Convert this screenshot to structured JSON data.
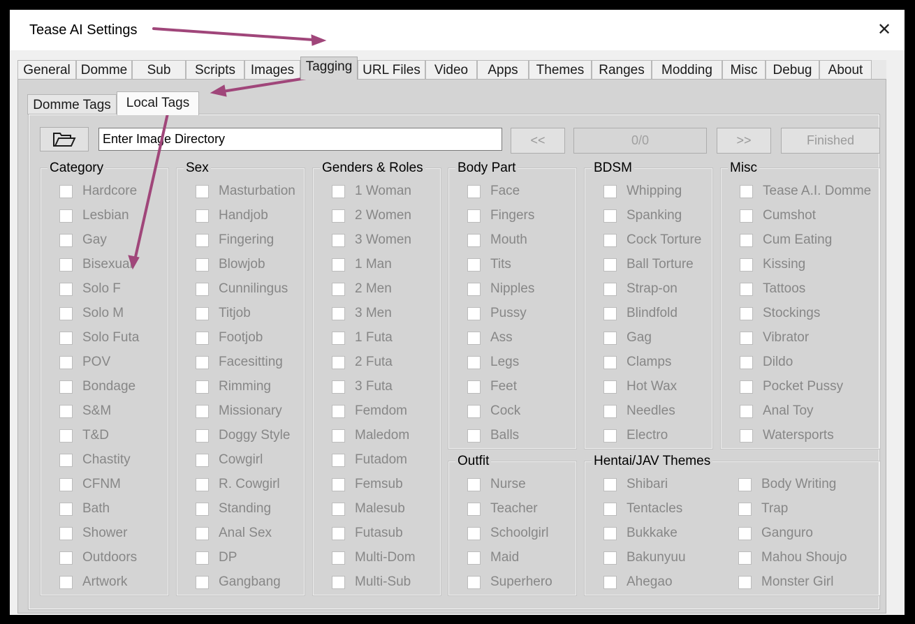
{
  "window": {
    "title": "Tease AI Settings",
    "close_glyph": "✕"
  },
  "main_tabs": [
    "General",
    "Domme",
    "Sub",
    "Scripts",
    "Images",
    "Tagging",
    "URL Files",
    "Video",
    "Apps",
    "Themes",
    "Ranges",
    "Modding",
    "Misc",
    "Debug",
    "About"
  ],
  "active_main_tab": "Tagging",
  "sub_tabs": [
    "Domme Tags",
    "Local Tags"
  ],
  "active_sub_tab": "Local Tags",
  "toolbar": {
    "folder_icon": "folder-open-icon",
    "directory_value": "Enter Image Directory",
    "prev_label": "<<",
    "progress_label": "0/0",
    "next_label": ">>",
    "finished_label": "Finished"
  },
  "groups": [
    {
      "label": "Category",
      "items": [
        "Hardcore",
        "Lesbian",
        "Gay",
        "Bisexual",
        "Solo F",
        "Solo M",
        "Solo Futa",
        "POV",
        "Bondage",
        "S&M",
        "T&D",
        "Chastity",
        "CFNM",
        "Bath",
        "Shower",
        "Outdoors",
        "Artwork"
      ]
    },
    {
      "label": "Sex",
      "items": [
        "Masturbation",
        "Handjob",
        "Fingering",
        "Blowjob",
        "Cunnilingus",
        "Titjob",
        "Footjob",
        "Facesitting",
        "Rimming",
        "Missionary",
        "Doggy Style",
        "Cowgirl",
        "R. Cowgirl",
        "Standing",
        "Anal Sex",
        "DP",
        "Gangbang"
      ]
    },
    {
      "label": "Genders & Roles",
      "items": [
        "1 Woman",
        "2 Women",
        "3 Women",
        "1 Man",
        "2 Men",
        "3 Men",
        "1 Futa",
        "2 Futa",
        "3 Futa",
        "Femdom",
        "Maledom",
        "Futadom",
        "Femsub",
        "Malesub",
        "Futasub",
        "Multi-Dom",
        "Multi-Sub"
      ]
    },
    {
      "label": "Body Part",
      "items": [
        "Face",
        "Fingers",
        "Mouth",
        "Tits",
        "Nipples",
        "Pussy",
        "Ass",
        "Legs",
        "Feet",
        "Cock",
        "Balls"
      ]
    },
    {
      "label": "BDSM",
      "items": [
        "Whipping",
        "Spanking",
        "Cock Torture",
        "Ball Torture",
        "Strap-on",
        "Blindfold",
        "Gag",
        "Clamps",
        "Hot Wax",
        "Needles",
        "Electro"
      ]
    },
    {
      "label": "Misc",
      "items": [
        "Tease A.I. Domme",
        "Cumshot",
        "Cum Eating",
        "Kissing",
        "Tattoos",
        "Stockings",
        "Vibrator",
        "Dildo",
        "Pocket Pussy",
        "Anal Toy",
        "Watersports"
      ]
    },
    {
      "label": "Outfit",
      "items": [
        "Nurse",
        "Teacher",
        "Schoolgirl",
        "Maid",
        "Superhero"
      ]
    },
    {
      "label": "Hentai/JAV Themes",
      "columns": [
        [
          "Shibari",
          "Tentacles",
          "Bukkake",
          "Bakunyuu",
          "Ahegao"
        ],
        [
          "Body Writing",
          "Trap",
          "Ganguro",
          "Mahou Shoujo",
          "Monster Girl"
        ]
      ]
    }
  ],
  "annotation_color": "#a0467a"
}
